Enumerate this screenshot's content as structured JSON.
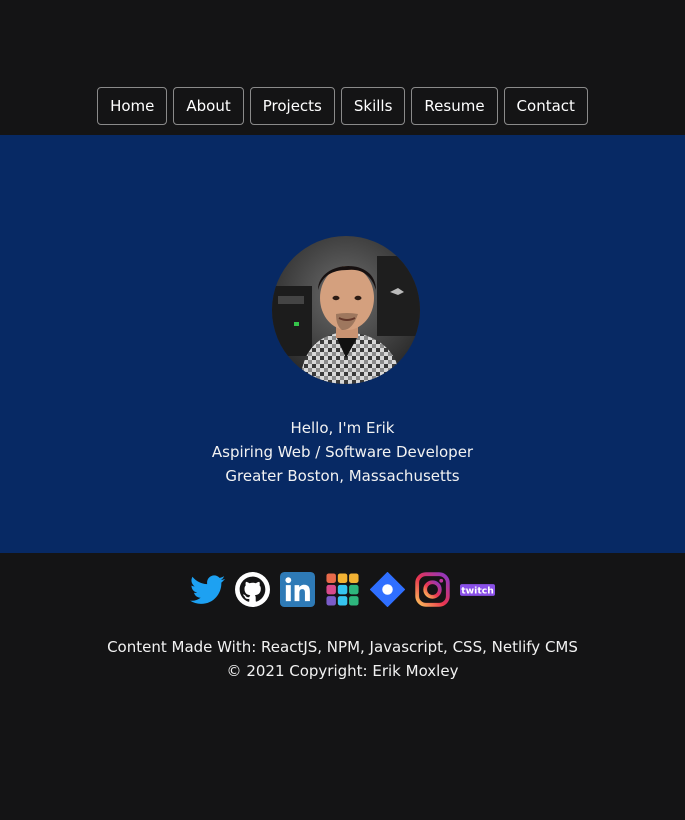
{
  "nav": {
    "items": [
      {
        "label": "Home"
      },
      {
        "label": "About"
      },
      {
        "label": "Projects"
      },
      {
        "label": "Skills"
      },
      {
        "label": "Resume"
      },
      {
        "label": "Contact"
      }
    ]
  },
  "hero": {
    "greeting": "Hello, I'm Erik",
    "role": "Aspiring Web / Software Developer",
    "location": "Greater Boston, Massachusetts"
  },
  "social": {
    "icons": [
      "twitter-icon",
      "github-icon",
      "linkedin-icon",
      "slack-icon",
      "blueprint-icon",
      "instagram-icon",
      "twitch-icon"
    ],
    "twitch_text": "twitch"
  },
  "footer": {
    "made_with": "Content Made With: ReactJS, NPM, Javascript, CSS, Netlify CMS",
    "copyright": "© 2021 Copyright: Erik Moxley"
  },
  "colors": {
    "page_bg": "#141415",
    "hero_bg": "#072964",
    "nav_border": "#8a8a8a"
  }
}
